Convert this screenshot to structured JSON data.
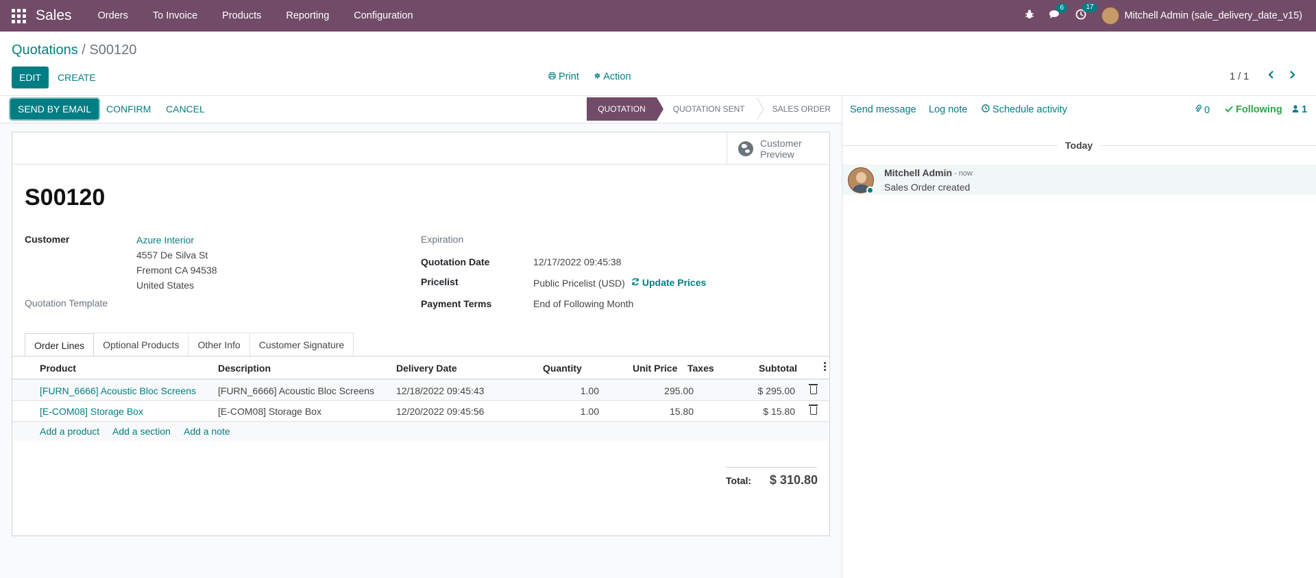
{
  "navbar": {
    "brand": "Sales",
    "menu": [
      "Orders",
      "To Invoice",
      "Products",
      "Reporting",
      "Configuration"
    ],
    "messages_count": "6",
    "activities_count": "17",
    "user": "Mitchell Admin (sale_delivery_date_v15)"
  },
  "control_panel": {
    "breadcrumb_parent": "Quotations",
    "breadcrumb_sep": "/",
    "breadcrumb_current": "S00120",
    "edit_label": "EDIT",
    "create_label": "CREATE",
    "print_label": "Print",
    "action_label": "Action",
    "pager": "1 / 1"
  },
  "statusbar": {
    "send_email": "SEND BY EMAIL",
    "confirm": "CONFIRM",
    "cancel": "CANCEL",
    "stages": [
      "QUOTATION",
      "QUOTATION SENT",
      "SALES ORDER"
    ],
    "active_stage": "QUOTATION"
  },
  "sheet": {
    "customer_preview": "Customer Preview",
    "title": "S00120",
    "customer_label": "Customer",
    "customer_name": "Azure Interior",
    "address_1": "4557 De Silva St",
    "address_2": "Fremont CA 94538",
    "address_3": "United States",
    "template_label": "Quotation Template",
    "expiration_label": "Expiration",
    "date_label": "Quotation Date",
    "date_value": "12/17/2022 09:45:38",
    "pricelist_label": "Pricelist",
    "pricelist_value": "Public Pricelist (USD)",
    "update_prices": "Update Prices",
    "terms_label": "Payment Terms",
    "terms_value": "End of Following Month"
  },
  "tabs": [
    "Order Lines",
    "Optional Products",
    "Other Info",
    "Customer Signature"
  ],
  "order_lines": {
    "columns": [
      "Product",
      "Description",
      "Delivery Date",
      "Quantity",
      "Unit Price",
      "Taxes",
      "Subtotal"
    ],
    "rows": [
      {
        "product": "[FURN_6666] Acoustic Bloc Screens",
        "description": "[FURN_6666] Acoustic Bloc Screens",
        "delivery": "12/18/2022 09:45:43",
        "qty": "1.00",
        "price": "295.00",
        "taxes": "",
        "subtotal": "$ 295.00"
      },
      {
        "product": "[E-COM08] Storage Box",
        "description": "[E-COM08] Storage Box",
        "delivery": "12/20/2022 09:45:56",
        "qty": "1.00",
        "price": "15.80",
        "taxes": "",
        "subtotal": "$ 15.80"
      }
    ],
    "add_product": "Add a product",
    "add_section": "Add a section",
    "add_note": "Add a note",
    "total_label": "Total:",
    "total_value": "$ 310.80"
  },
  "chatter": {
    "send_message": "Send message",
    "log_note": "Log note",
    "schedule_activity": "Schedule activity",
    "attachments": "0",
    "following": "Following",
    "followers": "1",
    "today": "Today",
    "message_author": "Mitchell Admin",
    "message_time": "- now",
    "message_body": "Sales Order created"
  },
  "colors": {
    "brand": "#714B67",
    "accent": "#017e84",
    "following": "#28a745"
  }
}
